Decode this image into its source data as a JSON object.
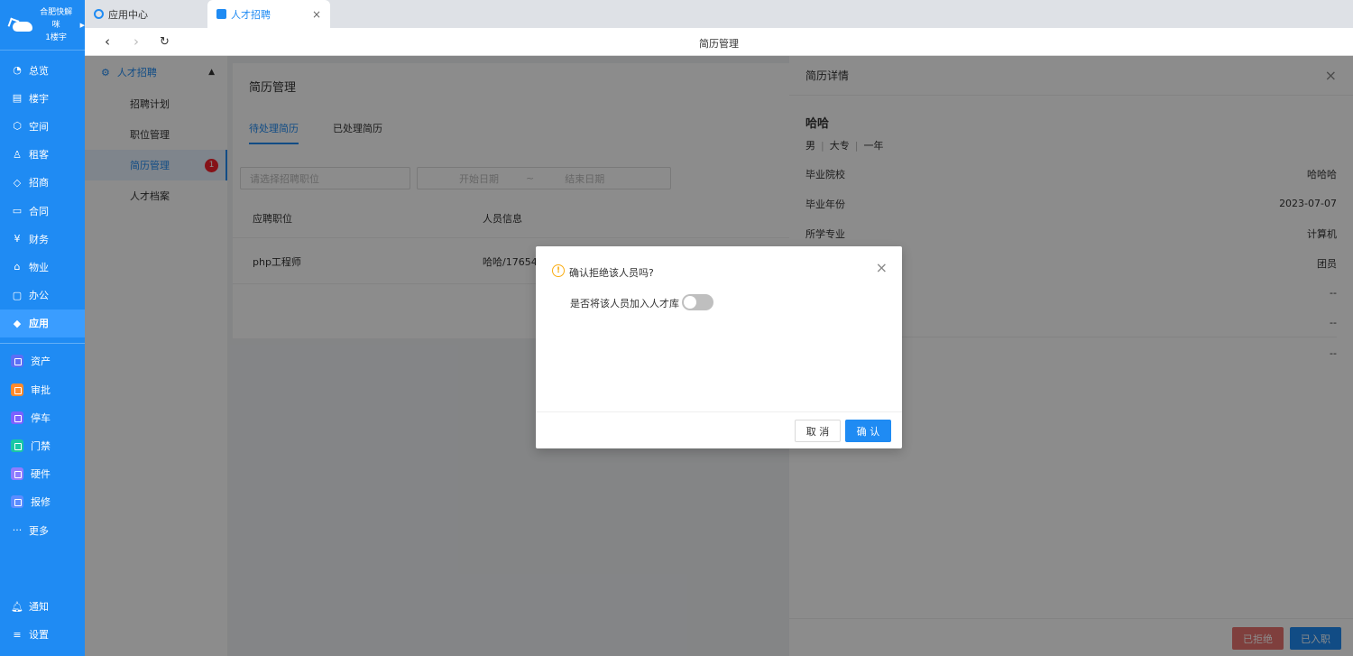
{
  "brand": {
    "line1": "合肥快解咪",
    "line2": "1楼宇"
  },
  "nav_main": [
    {
      "label": "总览",
      "icon": "◔"
    },
    {
      "label": "楼宇",
      "icon": "▤"
    },
    {
      "label": "空间",
      "icon": "⬡"
    },
    {
      "label": "租客",
      "icon": "♙"
    },
    {
      "label": "招商",
      "icon": "◇"
    },
    {
      "label": "合同",
      "icon": "▭"
    },
    {
      "label": "财务",
      "icon": "¥"
    },
    {
      "label": "物业",
      "icon": "⌂"
    },
    {
      "label": "办公",
      "icon": "▢"
    },
    {
      "label": "应用",
      "icon": "◆"
    }
  ],
  "nav_apps": [
    {
      "label": "资产",
      "color": "#5b6ef5"
    },
    {
      "label": "审批",
      "color": "#ff8a2b"
    },
    {
      "label": "停车",
      "color": "#7b61ff"
    },
    {
      "label": "门禁",
      "color": "#19c7a5"
    },
    {
      "label": "硬件",
      "color": "#8f7cff"
    },
    {
      "label": "报修",
      "color": "#5b8cff"
    }
  ],
  "nav_more": "更多",
  "nav_bottom": [
    {
      "label": "通知",
      "icon": "♫"
    },
    {
      "label": "设置",
      "icon": "≡"
    }
  ],
  "tabs": [
    {
      "label": "应用中心"
    },
    {
      "label": "人才招聘",
      "close": "×"
    }
  ],
  "toolbar": {
    "back": "‹",
    "forward": "›",
    "refresh": "↻",
    "title": "简历管理"
  },
  "submenu": {
    "group": "人才招聘",
    "items": [
      "招聘计划",
      "职位管理",
      "简历管理",
      "人才档案"
    ],
    "badge": "1"
  },
  "main": {
    "title": "简历管理",
    "tabs": [
      "待处理简历",
      "已处理简历"
    ],
    "position_placeholder": "请选择招聘职位",
    "start_date_placeholder": "开始日期",
    "date_sep": "~",
    "end_date_placeholder": "结束日期",
    "columns": [
      "应聘职位",
      "人员信息"
    ],
    "rows": [
      {
        "position": "php工程师",
        "person": "哈哈/17654"
      }
    ]
  },
  "drawer": {
    "title": "简历详情",
    "close": "×",
    "name": "哈哈",
    "gender": "男",
    "education": "大专",
    "experience": "一年",
    "fields": [
      {
        "key": "毕业院校",
        "value": "哈哈哈"
      },
      {
        "key": "毕业年份",
        "value": "2023-07-07"
      },
      {
        "key": "所学专业",
        "value": "计算机"
      },
      {
        "key": "",
        "value": "团员"
      },
      {
        "key": "",
        "value": "--"
      },
      {
        "key": "",
        "value": "--"
      },
      {
        "key": "",
        "value": "--"
      }
    ],
    "reject_label": "已拒绝",
    "hired_label": "已入职"
  },
  "dialog": {
    "title": "确认拒绝该人员吗?",
    "switch_label": "是否将该人员加入人才库",
    "switch_on": false,
    "close": "×",
    "cancel": "取 消",
    "confirm": "确 认"
  },
  "colors": {
    "primary": "#1f8bf3",
    "sidebar": "#1f8bf3",
    "warning": "#faad14",
    "danger": "#f5222d",
    "reject": "#e8736f"
  }
}
